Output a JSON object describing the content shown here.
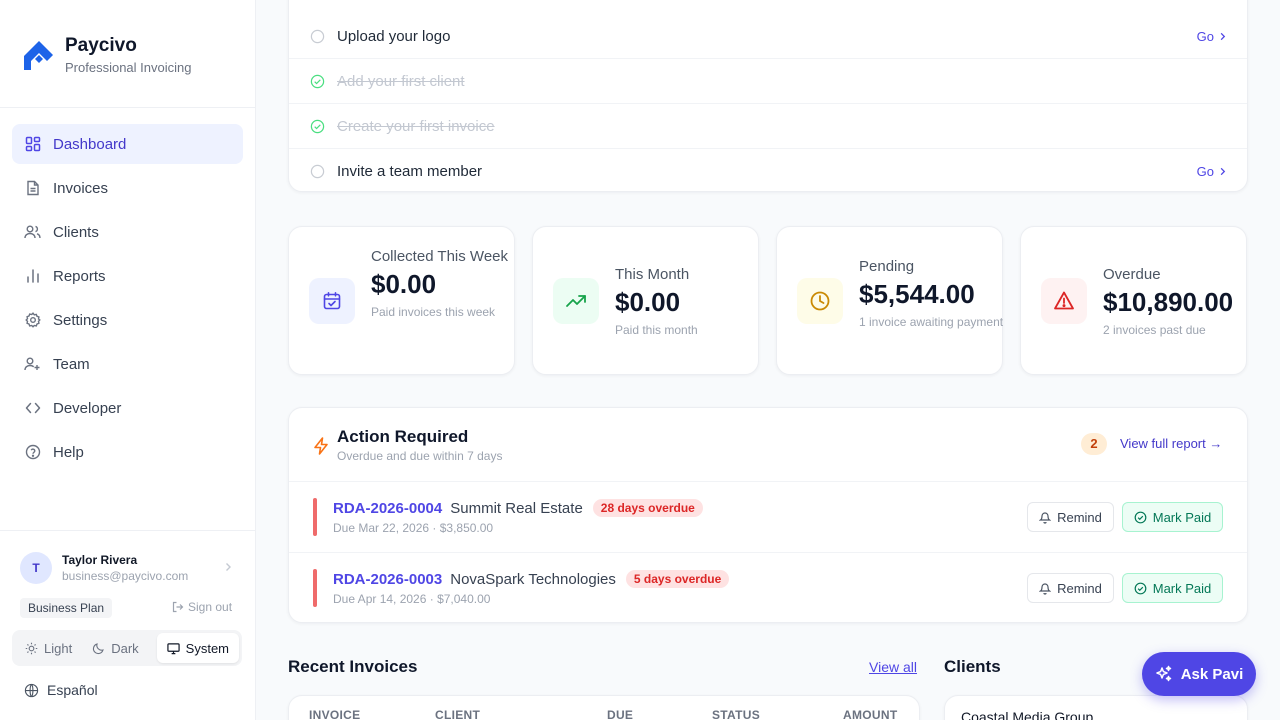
{
  "brand": {
    "name": "Paycivo",
    "tagline": "Professional Invoicing",
    "accent": "#1d63e8"
  },
  "sidebar": {
    "items": [
      {
        "label": "Dashboard",
        "icon": "dashboard-icon",
        "active": true
      },
      {
        "label": "Invoices",
        "icon": "file-icon"
      },
      {
        "label": "Clients",
        "icon": "users-icon"
      },
      {
        "label": "Reports",
        "icon": "bar-chart-icon"
      },
      {
        "label": "Settings",
        "icon": "gear-icon"
      },
      {
        "label": "Team",
        "icon": "user-plus-icon"
      },
      {
        "label": "Developer",
        "icon": "code-icon"
      },
      {
        "label": "Help",
        "icon": "help-icon"
      }
    ],
    "user": {
      "initial": "T",
      "name": "Taylor Rivera",
      "email": "business@paycivo.com"
    },
    "plan": "Business Plan",
    "sign_out": "Sign out",
    "theme": {
      "light": "Light",
      "dark": "Dark",
      "system": "System",
      "selected": "System"
    },
    "language": "Español"
  },
  "checklist": [
    {
      "label": "Upload your logo",
      "done": false,
      "action": "Go"
    },
    {
      "label": "Add your first client",
      "done": true
    },
    {
      "label": "Create your first invoice",
      "done": true
    },
    {
      "label": "Invite a team member",
      "done": false,
      "action": "Go"
    }
  ],
  "stats": [
    {
      "label": "Collected This Week",
      "value": "$0.00",
      "sub": "Paid invoices this week",
      "color": "#4f46e5"
    },
    {
      "label": "This Month",
      "value": "$0.00",
      "sub": "Paid this month",
      "color": "#16a34a"
    },
    {
      "label": "Pending",
      "value": "$5,544.00",
      "sub": "1 invoice awaiting payment",
      "color": "#ca8a04"
    },
    {
      "label": "Overdue",
      "value": "$10,890.00",
      "sub": "2 invoices past due",
      "color": "#dc2626"
    }
  ],
  "action_required": {
    "title": "Action Required",
    "subtitle": "Overdue and due within 7 days",
    "count": "2",
    "view_report": "View full report →",
    "remind_label": "Remind",
    "mark_paid_label": "Mark Paid",
    "rows": [
      {
        "id": "RDA-2026-0004",
        "client": "Summit Real Estate",
        "badge": "28 days overdue",
        "due": "Due Mar 22, 2026 · $3,850.00"
      },
      {
        "id": "RDA-2026-0003",
        "client": "NovaSpark Technologies",
        "badge": "5 days overdue",
        "due": "Due Apr 14, 2026 · $7,040.00"
      }
    ]
  },
  "recent_invoices": {
    "title": "Recent Invoices",
    "view_all": "View all",
    "columns": [
      "INVOICE",
      "CLIENT",
      "DUE",
      "STATUS",
      "AMOUNT"
    ]
  },
  "clients": {
    "title": "Clients",
    "first": "Coastal Media Group"
  },
  "assistant": {
    "label": "Ask Pavi"
  }
}
